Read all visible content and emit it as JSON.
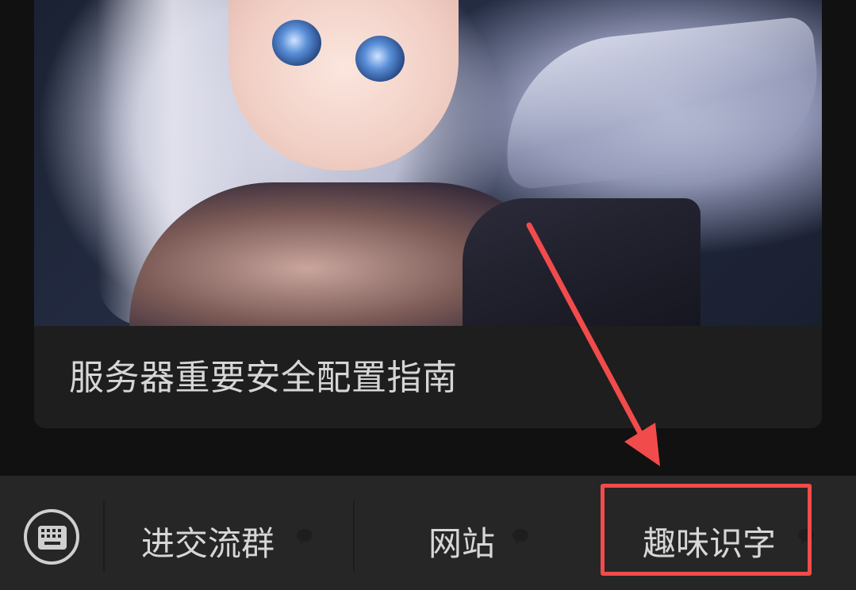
{
  "article": {
    "title": "服务器重要安全配置指南",
    "cover_image": "anime-girl-illustration"
  },
  "menu_bar": {
    "keyboard_icon": "keyboard-icon",
    "items": [
      {
        "label": "进交流群"
      },
      {
        "label": "网站"
      },
      {
        "label": "趣味识字"
      }
    ],
    "submenu_icon": "speech-bubble-icon"
  },
  "annotation": {
    "highlight_color": "#f24b4b",
    "arrow_color": "#f24b4b"
  },
  "colors": {
    "background": "#111111",
    "card": "#1e1e1e",
    "menu_bar": "#262626",
    "text": "#d7d7d7"
  }
}
